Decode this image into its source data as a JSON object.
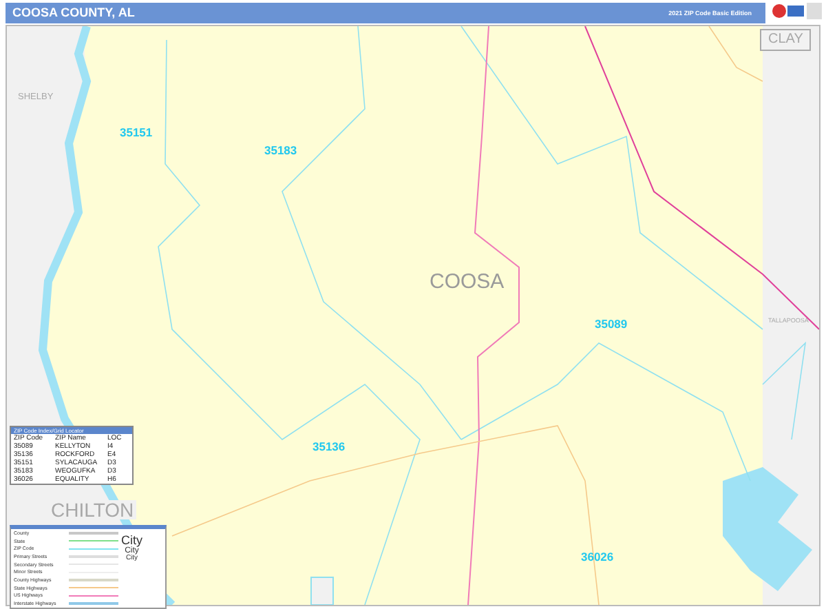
{
  "header": {
    "title": "COOSA COUNTY, AL",
    "edition": "2021 ZIP Code Basic Edition"
  },
  "map": {
    "county_label": "COOSA",
    "neighbors": [
      {
        "label": "CLAY",
        "kind": "boxed"
      },
      {
        "label": "SHELBY",
        "kind": "small"
      },
      {
        "label": "TALLAPOOSA",
        "kind": "tiny"
      },
      {
        "label": "CHILTON",
        "kind": "large"
      }
    ],
    "zip_labels": [
      "35151",
      "35183",
      "35089",
      "35136",
      "36026"
    ]
  },
  "zip_locator": {
    "title": "ZIP Code Index/Grid Locator",
    "columns": [
      "ZIP Code",
      "ZIP Name",
      "LOC"
    ],
    "rows": [
      [
        "35089",
        "KELLYTON",
        "I4"
      ],
      [
        "35136",
        "ROCKFORD",
        "E4"
      ],
      [
        "35151",
        "SYLACAUGA",
        "D3"
      ],
      [
        "35183",
        "WEOGUFKA",
        "D3"
      ],
      [
        "36026",
        "EQUALITY",
        "H6"
      ]
    ]
  },
  "legend": {
    "items": [
      {
        "label": "County",
        "color": "#c8c8c8"
      },
      {
        "label": "State",
        "color": "#7ee08a"
      },
      {
        "label": "ZIP Code",
        "color": "#7fe3f0"
      },
      {
        "label": "Primary Streets",
        "color": "#dddddd"
      },
      {
        "label": "Secondary Streets",
        "color": "#e6e6e6"
      },
      {
        "label": "Minor Streets",
        "color": "#eeeeee"
      },
      {
        "label": "County Highways",
        "color": "#d8d8c8"
      },
      {
        "label": "State Highways",
        "color": "#f5c98a"
      },
      {
        "label": "US Highways",
        "color": "#f07ab8"
      },
      {
        "label": "Interstate Highways",
        "color": "#8fc8e8"
      }
    ],
    "city_samples": [
      "City",
      "City",
      "City"
    ]
  }
}
